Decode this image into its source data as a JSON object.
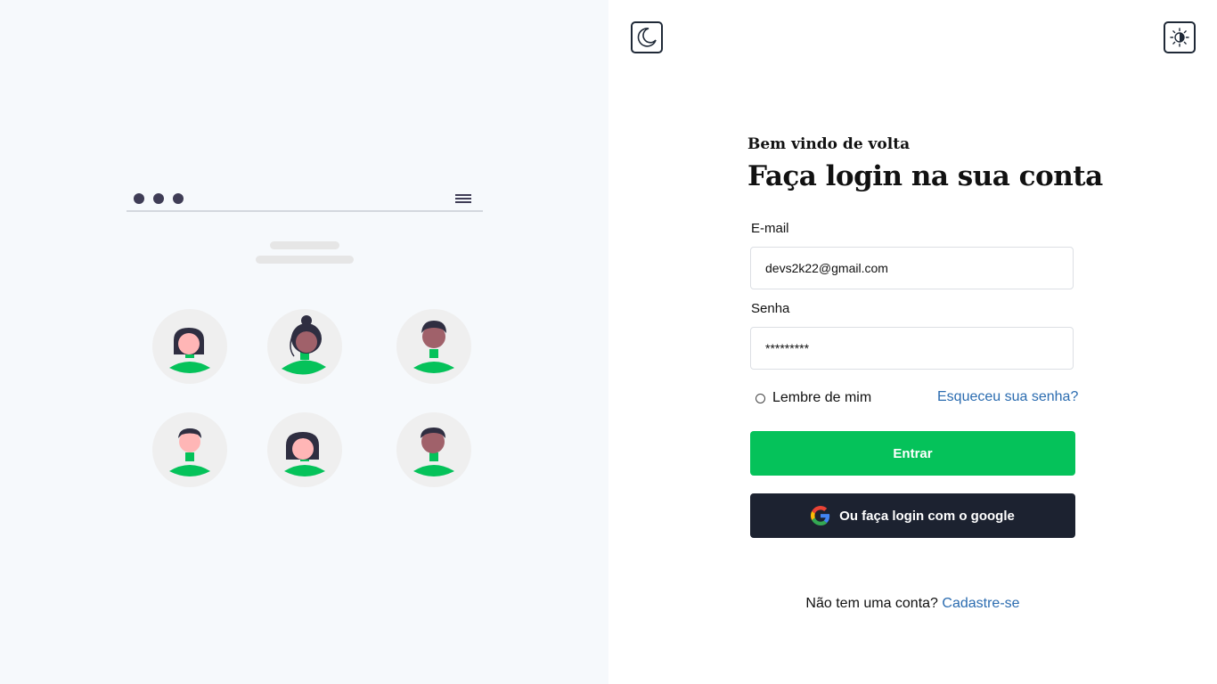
{
  "illustration": {
    "avatars": [
      "female-avatar",
      "female-bun-avatar",
      "male-avatar",
      "male-avatar",
      "female-bob-avatar",
      "male-avatar"
    ]
  },
  "theme": {
    "dark_icon": "moon-icon",
    "light_icon": "sun-contrast-icon"
  },
  "login": {
    "welcome": "Bem vindo de volta",
    "title": "Faça login na sua conta",
    "email_label": "E-mail",
    "email_value": "devs2k22@gmail.com",
    "password_label": "Senha",
    "password_value": "*********",
    "remember_label": "Lembre de mim",
    "forgot_link": "Esqueceu sua senha?",
    "submit_label": "Entrar",
    "google_label": "Ou faça login com o google",
    "no_account_text": "Não tem uma conta?",
    "signup_link": "Cadastre-se"
  },
  "colors": {
    "accent_green": "#05c25a",
    "dark_button": "#1c2230",
    "link": "#2b6cb0"
  }
}
